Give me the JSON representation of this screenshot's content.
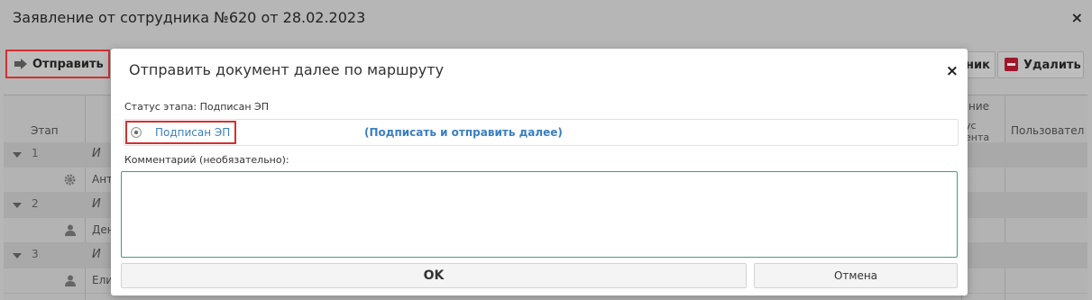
{
  "background_window": {
    "title": "Заявление от сотрудника №620 от 28.02.2023",
    "close_glyph": "×",
    "toolbar": {
      "send_label": "Отправить",
      "send_icon": "arrow-right-icon",
      "right_button_partial": "ник",
      "delete_label": "Удалить",
      "delete_icon": "minus-icon"
    },
    "table": {
      "headers": {
        "stage": "Этап",
        "group_partial": "ние",
        "status_partial_1": "ус",
        "status_partial_2": "ента",
        "user_partial": "Пользовател"
      },
      "rows": [
        {
          "type": "group",
          "num": "1",
          "text": "И"
        },
        {
          "type": "item",
          "icon": "gear-icon",
          "text": "Ант"
        },
        {
          "type": "group",
          "num": "2",
          "text": "И"
        },
        {
          "type": "item",
          "icon": "person-icon",
          "text": "Ден"
        },
        {
          "type": "group",
          "num": "3",
          "text": "И"
        },
        {
          "type": "item",
          "icon": "person-icon",
          "text": "Ели"
        }
      ]
    }
  },
  "modal": {
    "title": "Отправить документ далее по маршруту",
    "close_glyph": "×",
    "status_label": "Статус этапа: Подписан ЭП",
    "option": {
      "label": "Подписан ЭП",
      "action": "(Подписать и отправить далее)",
      "selected": true
    },
    "comment_label": "Комментарий (необязательно):",
    "comment_value": "",
    "ok_label": "OK",
    "cancel_label": "Отмена"
  },
  "colors": {
    "highlight": "#d43030",
    "link": "#3a7fc1",
    "input_border": "#3ba56a",
    "delete_accent": "#a0162a"
  }
}
